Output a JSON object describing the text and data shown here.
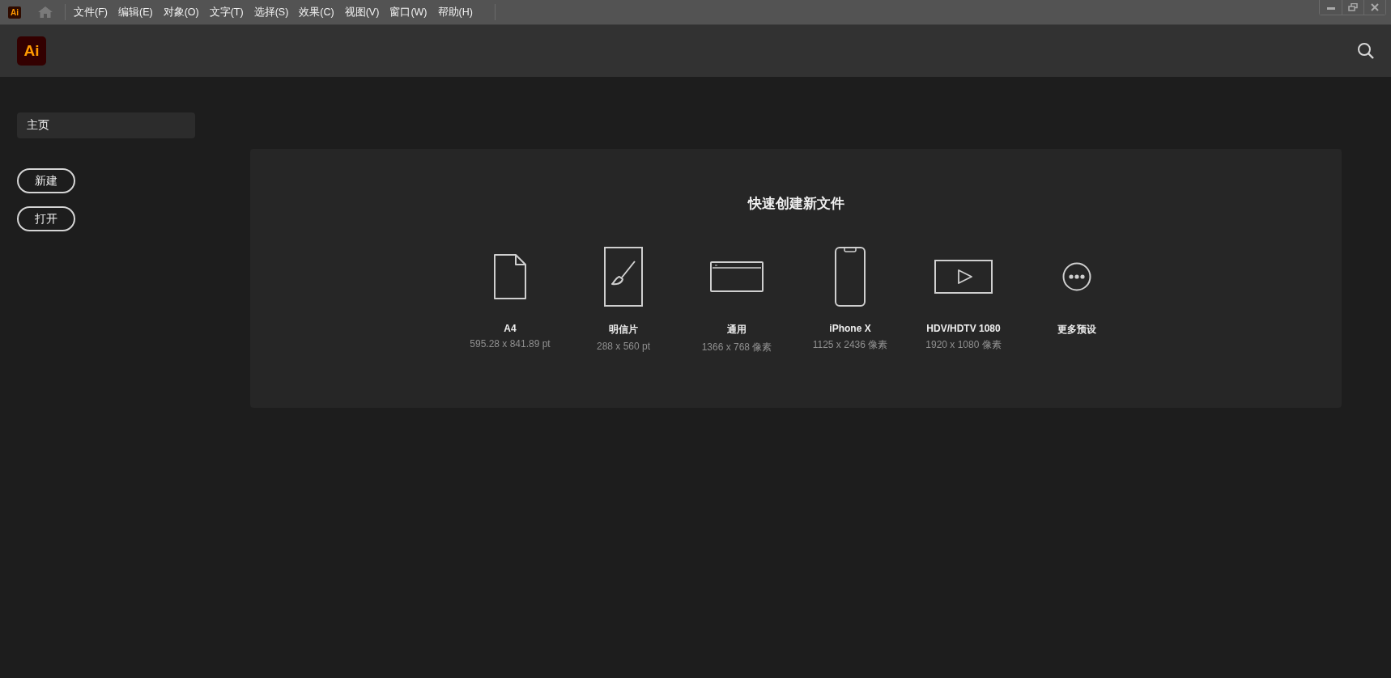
{
  "app_logo": {
    "text": "Ai"
  },
  "menu_bar": {
    "items": [
      "文件(F)",
      "编辑(E)",
      "对象(O)",
      "文字(T)",
      "选择(S)",
      "效果(C)",
      "视图(V)",
      "窗口(W)",
      "帮助(H)"
    ]
  },
  "header": {
    "logo": "Ai"
  },
  "sidebar": {
    "items": [
      {
        "label": "主页",
        "selected": true
      }
    ],
    "buttons": [
      "新建",
      "打开"
    ]
  },
  "quick_create": {
    "title": "快速创建新文件",
    "presets": [
      {
        "kind": "document",
        "name": "A4",
        "size": "595.28 x 841.89 pt"
      },
      {
        "kind": "postcard",
        "name": "明信片",
        "size": "288 x 560 pt"
      },
      {
        "kind": "web",
        "name": "通用",
        "size": "1366 x 768 像素"
      },
      {
        "kind": "phone",
        "name": "iPhone X",
        "size": "1125 x 2436 像素"
      },
      {
        "kind": "video",
        "name": "HDV/HDTV 1080",
        "size": "1920 x 1080 像素"
      },
      {
        "kind": "more",
        "name": "更多预设"
      }
    ]
  }
}
